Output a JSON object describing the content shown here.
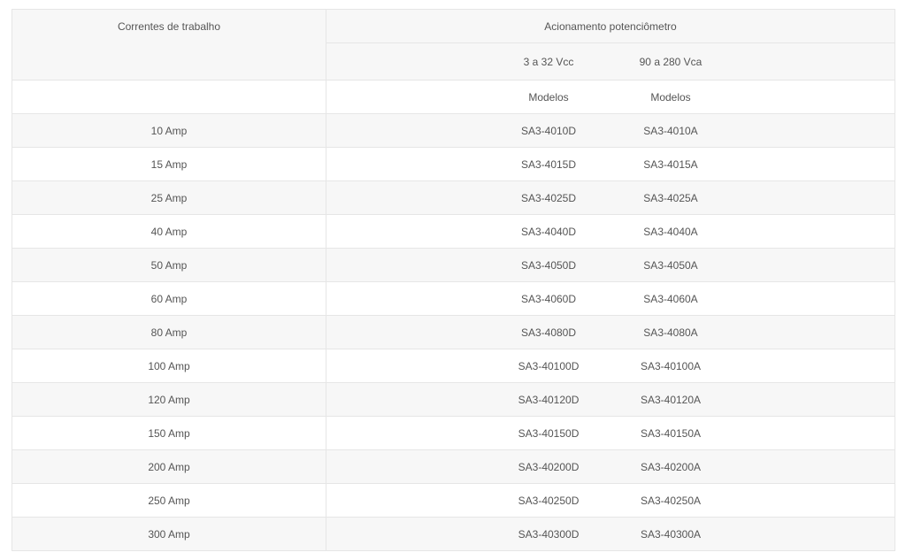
{
  "table": {
    "header": {
      "col1": "Correntes de trabalho",
      "col2": "Acionamento potenciômetro",
      "sub_left": "3 a 32 Vcc",
      "sub_right": "90 a 280 Vca",
      "models_left": "Modelos",
      "models_right": "Modelos"
    },
    "rows": [
      {
        "current": "10 Amp",
        "dc": "SA3-4010D",
        "ac": "SA3-4010A"
      },
      {
        "current": "15 Amp",
        "dc": "SA3-4015D",
        "ac": "SA3-4015A"
      },
      {
        "current": "25 Amp",
        "dc": "SA3-4025D",
        "ac": "SA3-4025A"
      },
      {
        "current": "40 Amp",
        "dc": "SA3-4040D",
        "ac": "SA3-4040A"
      },
      {
        "current": "50 Amp",
        "dc": "SA3-4050D",
        "ac": "SA3-4050A"
      },
      {
        "current": "60 Amp",
        "dc": "SA3-4060D",
        "ac": "SA3-4060A"
      },
      {
        "current": "80 Amp",
        "dc": "SA3-4080D",
        "ac": "SA3-4080A"
      },
      {
        "current": "100 Amp",
        "dc": "SA3-40100D",
        "ac": "SA3-40100A"
      },
      {
        "current": "120 Amp",
        "dc": "SA3-40120D",
        "ac": "SA3-40120A"
      },
      {
        "current": "150 Amp",
        "dc": "SA3-40150D",
        "ac": "SA3-40150A"
      },
      {
        "current": "200 Amp",
        "dc": "SA3-40200D",
        "ac": "SA3-40200A"
      },
      {
        "current": "250 Amp",
        "dc": "SA3-40250D",
        "ac": "SA3-40250A"
      },
      {
        "current": "300 Amp",
        "dc": "SA3-40300D",
        "ac": "SA3-40300A"
      }
    ]
  },
  "colors": {
    "stripe": "#f7f7f7",
    "border": "#e6e6e6",
    "text": "#555555"
  }
}
